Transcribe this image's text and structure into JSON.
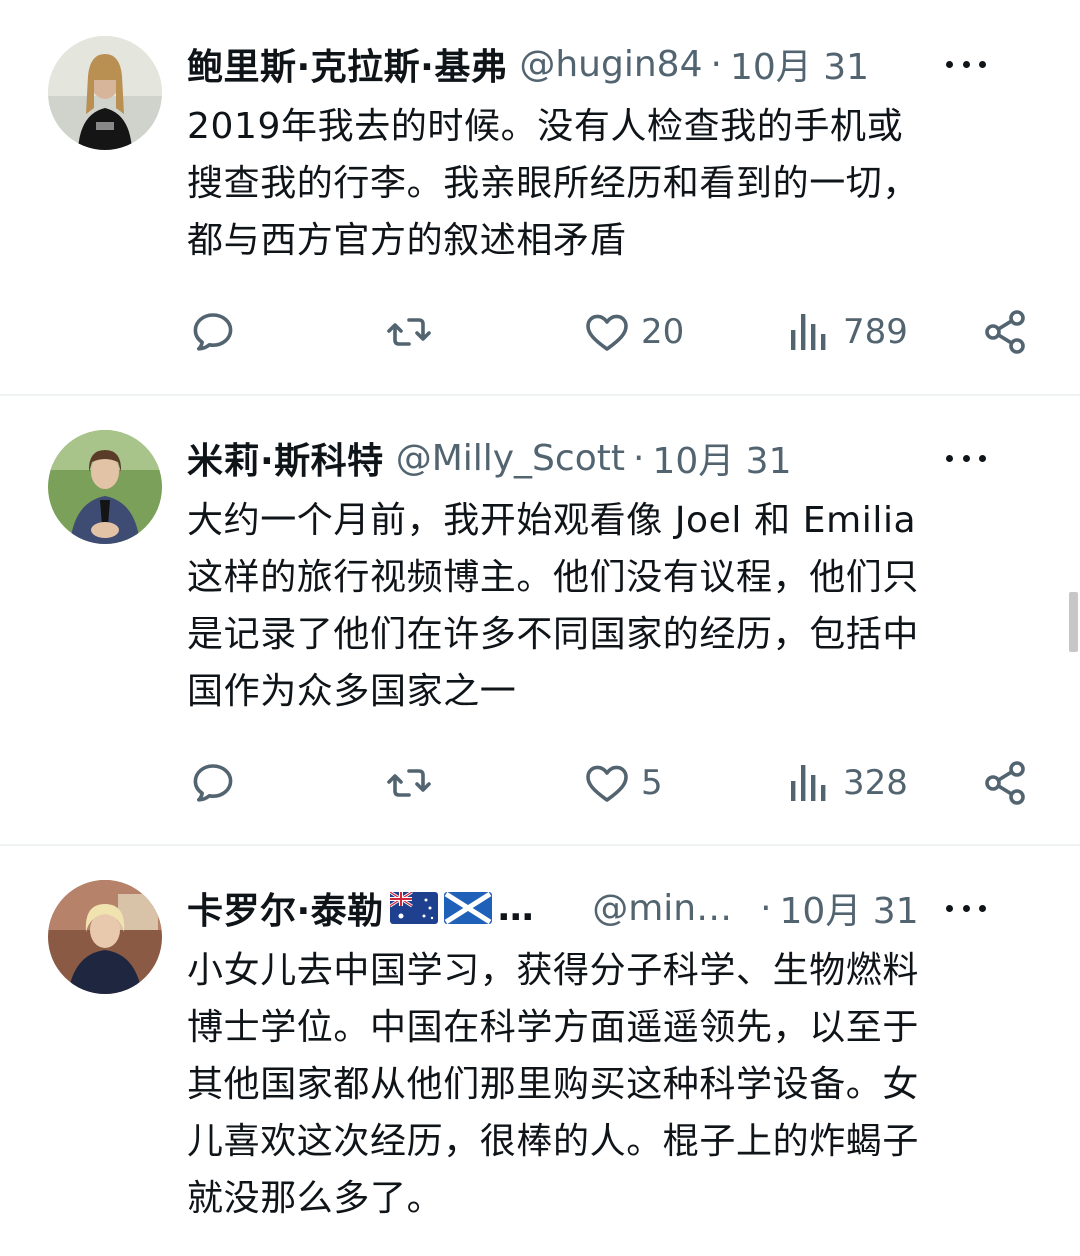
{
  "tweets": [
    {
      "name": "鲍里斯·克拉斯·基弗",
      "handle": "@hugin84",
      "separator": "·",
      "date": "10月 31",
      "text": "2019年我去的时候。没有人检查我的手机或\n搜查我的行李。我亲眼所经历和看到的一切，\n都与西方官方的叙述相矛盾",
      "likes": "20",
      "views": "789"
    },
    {
      "name": "米莉·斯科特",
      "handle": "@Milly_Scott",
      "separator": "·",
      "date": "10月 31",
      "text": "大约一个月前，我开始观看像 Joel 和 Emilia\n这样的旅行视频博主。他们没有议程，他们只\n是记录了他们在许多不同国家的经历，包括中\n国作为众多国家之一",
      "likes": "5",
      "views": "328"
    },
    {
      "name": "卡罗尔·泰勒",
      "name_suffix": "…",
      "handle": "@min…",
      "separator": "·",
      "date": "10月 31",
      "text": "小女儿去中国学习，获得分子科学、生物燃料\n博士学位。中国在科学方面遥遥领先，以至于\n其他国家都从他们那里购买这种科学设备。女\n儿喜欢这次经历，很棒的人。棍子上的炸蝎子\n就没那么多了。"
    }
  ],
  "icons": {
    "reply": "reply-icon",
    "retweet": "retweet-icon",
    "like": "heart-icon",
    "views": "views-icon",
    "share": "share-icon",
    "more": "more-icon"
  },
  "colors": {
    "text": "#0f1419",
    "secondary": "#536471",
    "divider": "#eff3f4"
  }
}
